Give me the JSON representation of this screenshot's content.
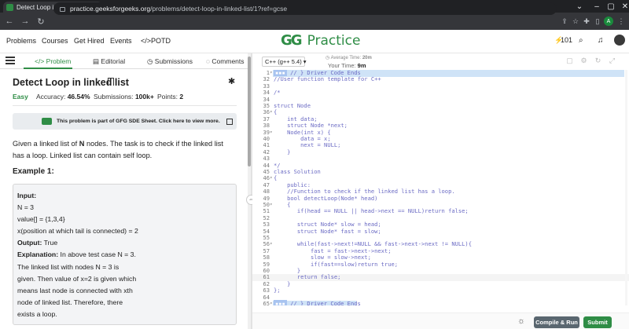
{
  "browser": {
    "tab_title": "Detect Loop in linked list | Practi",
    "tab_close": "×",
    "new_tab": "+",
    "url_host": "practice.geeksforgeeks.org",
    "url_path": "/problems/detect-loop-in-linked-list/1?ref=gcse",
    "profile_initial": "A"
  },
  "site": {
    "nav": [
      "Problems",
      "Courses",
      "Get Hired",
      "Events",
      "</>POTD"
    ],
    "brand_logo": "GG",
    "brand_name": "Practice",
    "streak": "101"
  },
  "problem_tabs": {
    "problem": "Problem",
    "editorial": "Editorial",
    "submissions": "Submissions",
    "comments": "Comments"
  },
  "problem": {
    "title": "Detect Loop in linked list",
    "difficulty": "Easy",
    "accuracy_label": "Accuracy:",
    "accuracy": "46.54%",
    "submissions_label": "Submissions:",
    "submissions": "100k+",
    "points_label": "Points:",
    "points": "2",
    "banner": "This problem is part of GFG SDE Sheet. Click here to view more.",
    "desc_1": "Given a linked list of ",
    "desc_n": "N",
    "desc_2": " nodes. The task is to check if the linked list has a loop. Linked list can contain self loop.",
    "example_title": "Example 1:",
    "example": {
      "input_label": "Input:",
      "line1": "N = 3",
      "line2": "value[] = {1,3,4}",
      "line3": "x(position at which tail is connected) = 2",
      "output_label": "Output:",
      "output": " True",
      "expl_label": "Explanation:",
      "expl1": " In above test case N = 3.",
      "expl2": "The linked list with nodes N = 3 is",
      "expl3": "given. Then value of x=2 is given which",
      "expl4": "means last node is connected with xth",
      "expl5": "node of linked list. Therefore, there",
      "expl6": "exists a loop."
    }
  },
  "editor": {
    "language": "C++ (g++ 5.4)",
    "avg_time_label": "Average Time:",
    "avg_time": "20m",
    "your_time_label": "Your Time:",
    "your_time": "9m",
    "compile_label": "Compile & Run",
    "submit_label": "Submit",
    "lines": [
      {
        "n": "1",
        "code": "// } Driver Code Ends",
        "tag": true
      },
      {
        "n": "32",
        "code": "//User function template for C++"
      },
      {
        "n": "33",
        "code": ""
      },
      {
        "n": "34",
        "code": "/*"
      },
      {
        "n": "34",
        "code": ""
      },
      {
        "n": "35",
        "code": "struct Node"
      },
      {
        "n": "36",
        "code": "{"
      },
      {
        "n": "37",
        "code": "    int data;"
      },
      {
        "n": "38",
        "code": "    struct Node *next;"
      },
      {
        "n": "39",
        "code": "    Node(int x) {"
      },
      {
        "n": "40",
        "code": "        data = x;"
      },
      {
        "n": "41",
        "code": "        next = NULL;"
      },
      {
        "n": "42",
        "code": "    }"
      },
      {
        "n": "43",
        "code": ""
      },
      {
        "n": "44",
        "code": "*/"
      },
      {
        "n": "45",
        "code": "class Solution"
      },
      {
        "n": "46",
        "code": "{"
      },
      {
        "n": "47",
        "code": "    public:"
      },
      {
        "n": "48",
        "code": "    //Function to check if the linked list has a loop."
      },
      {
        "n": "49",
        "code": "    bool detectLoop(Node* head)"
      },
      {
        "n": "50",
        "code": "    {"
      },
      {
        "n": "51",
        "code": "       if(head == NULL || head->next == NULL)return false;"
      },
      {
        "n": "52",
        "code": ""
      },
      {
        "n": "53",
        "code": "       struct Node* slow = head;"
      },
      {
        "n": "54",
        "code": "       struct Node* fast = slow;"
      },
      {
        "n": "55",
        "code": ""
      },
      {
        "n": "56",
        "code": "       while(fast->next!=NULL && fast->next->next != NULL){"
      },
      {
        "n": "57",
        "code": "           fast = fast->next->next;"
      },
      {
        "n": "58",
        "code": "           slow = slow->next;"
      },
      {
        "n": "59",
        "code": "           if(fast==slow)return true;"
      },
      {
        "n": "60",
        "code": "       }"
      },
      {
        "n": "61",
        "code": "       return false;"
      },
      {
        "n": "62",
        "code": "    }"
      },
      {
        "n": "63",
        "code": "};"
      },
      {
        "n": "64",
        "code": ""
      },
      {
        "n": "65",
        "code": "// } Driver Code Ends",
        "tag": true
      }
    ]
  }
}
